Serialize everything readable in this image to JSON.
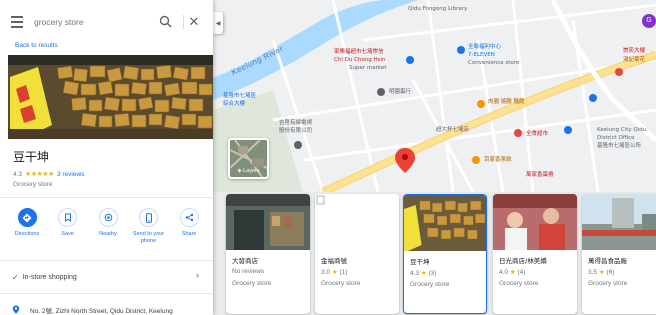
{
  "search": {
    "placeholder": "grocery store"
  },
  "panel": {
    "back_label": "Back to results",
    "title": "豆干坤",
    "rating": "4.3",
    "reviews_label": "3 reviews",
    "category": "Grocery store",
    "actions": [
      {
        "label": "Directions",
        "icon": "directions-icon"
      },
      {
        "label": "Save",
        "icon": "bookmark-icon"
      },
      {
        "label": "Nearby",
        "icon": "nearby-icon"
      },
      {
        "label": "Send to your phone",
        "icon": "phone-icon"
      },
      {
        "label": "Share",
        "icon": "share-icon"
      }
    ],
    "instore_label": "In-store shopping",
    "address": "No. 2號, Zizhi North Street, Qidu District, Keelung"
  },
  "map": {
    "river_label": "Keelung River",
    "layers_label": "Layers",
    "labels": [
      "家樂福超市七堵崇信",
      "Chi Du Chong Hsin",
      "Super market",
      "超大杯七堵店",
      "明園蛋行",
      "全聯福利中心",
      "7-ELEVEN",
      "Convenience store",
      "Keelung City Qidu",
      "District Office",
      "基隆市七堵區公所",
      "全食超市",
      "百家香茶飲",
      "萬家香蛋捲",
      "吉陞有線電視",
      "股份有限公司",
      "肉圓 燒臘 麵館",
      "Qidu Fongong Library",
      "崇奕大樓",
      "湯記菊花",
      "基隆市七堵區",
      "綜合大樓"
    ],
    "avatar_letter": "G"
  },
  "cards": [
    {
      "name": "大發商店",
      "reviews": "No reviews",
      "rating": "",
      "count": "",
      "category": "Grocery store"
    },
    {
      "name": "金福商號",
      "reviews": "",
      "rating": "3.0",
      "count": "(1)",
      "category": "Grocery store"
    },
    {
      "name": "豆干坤",
      "reviews": "",
      "rating": "4.3",
      "count": "(3)",
      "category": "Grocery store"
    },
    {
      "name": "日光商店/林美嬌",
      "reviews": "",
      "rating": "4.0",
      "count": "(4)",
      "category": "Grocery store"
    },
    {
      "name": "萬得昌食品廠",
      "reviews": "",
      "rating": "3.5",
      "count": "(6)",
      "category": "Grocery store"
    }
  ],
  "colors": {
    "accent": "#1a73e8",
    "star": "#f4b400",
    "pin": "#ea4335",
    "road_major": "#fde293"
  }
}
